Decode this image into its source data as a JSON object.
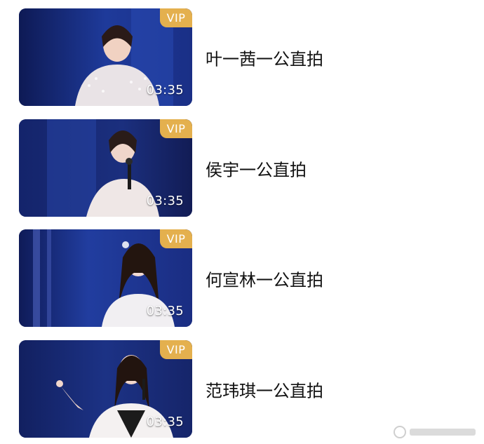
{
  "videos": [
    {
      "title": "叶一茜一公直拍",
      "badge": "VIP",
      "duration": "03:35"
    },
    {
      "title": "侯宇一公直拍",
      "badge": "VIP",
      "duration": "03:35"
    },
    {
      "title": "何宣林一公直拍",
      "badge": "VIP",
      "duration": "03:35"
    },
    {
      "title": "范玮琪一公直拍",
      "badge": "VIP",
      "duration": "03:35"
    }
  ],
  "colors": {
    "vip_badge": "#e4b04e",
    "thumbnail_background": "#142266",
    "title_text": "#111111"
  }
}
